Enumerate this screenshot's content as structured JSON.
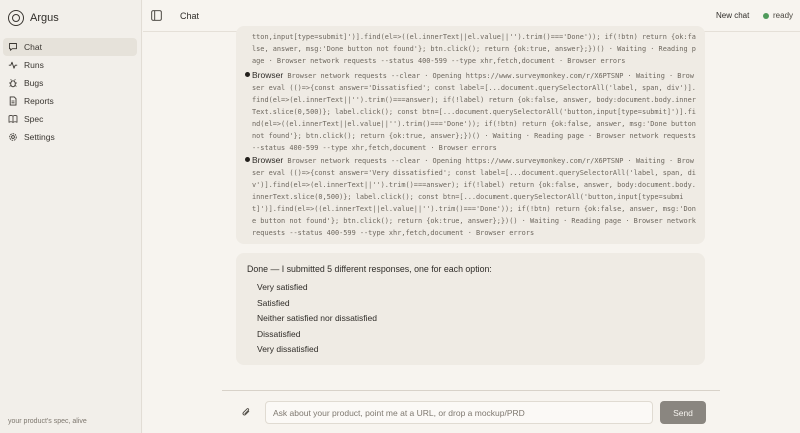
{
  "app": {
    "name": "Argus",
    "tagline": "your product's spec, alive"
  },
  "sidebar": {
    "items": [
      {
        "label": "Chat",
        "icon": "chat-bubble-icon",
        "active": true
      },
      {
        "label": "Runs",
        "icon": "activity-icon"
      },
      {
        "label": "Bugs",
        "icon": "bug-icon"
      },
      {
        "label": "Reports",
        "icon": "document-icon"
      },
      {
        "label": "Spec",
        "icon": "book-icon"
      },
      {
        "label": "Settings",
        "icon": "gear-icon"
      }
    ]
  },
  "header": {
    "title": "Chat",
    "new_chat_label": "New chat",
    "status": "ready",
    "status_color": "#4f9a5b"
  },
  "tools": {
    "partial_text": "tton,input[type=submit]')].find(el=>((el.innerText||el.value||'').trim()==='Done')); if(!btn) return {ok:false, answer, msg:'Done button not found'}; btn.click(); return {ok:true, answer};})() · Waiting · Reading page · Browser network requests --status 400-599 --type xhr,fetch,document · Browser errors",
    "entries": [
      {
        "name": "Browser",
        "text": "Browser network requests --clear · Opening https://www.surveymonkey.com/r/X6PTSNP · Waiting · Browser eval (()=>{const answer='Dissatisfied'; const label=[...document.querySelectorAll('label, span, div')].find(el=>(el.innerText||'').trim()===answer); if(!label) return {ok:false, answer, body:document.body.innerText.slice(0,500)}; label.click(); const btn=[...document.querySelectorAll('button,input[type=submit]')].find(el=>((el.innerText||el.value||'').trim()==='Done')); if(!btn) return {ok:false, answer, msg:'Done button not found'}; btn.click(); return {ok:true, answer};})() · Waiting · Reading page · Browser network requests --status 400-599 --type xhr,fetch,document · Browser errors"
      },
      {
        "name": "Browser",
        "text": "Browser network requests --clear · Opening https://www.surveymonkey.com/r/X6PTSNP · Waiting · Browser eval (()=>{const answer='Very dissatisfied'; const label=[...document.querySelectorAll('label, span, div')].find(el=>(el.innerText||'').trim()===answer); if(!label) return {ok:false, answer, body:document.body.innerText.slice(0,500)}; label.click(); const btn=[...document.querySelectorAll('button,input[type=submit]')].find(el=>((el.innerText||el.value||'').trim()==='Done')); if(!btn) return {ok:false, answer, msg:'Done button not found'}; btn.click(); return {ok:true, answer};})() · Waiting · Reading page · Browser network requests --status 400-599 --type xhr,fetch,document · Browser errors"
      }
    ]
  },
  "answer": {
    "intro": "Done — I submitted 5 different responses, one for each option:",
    "items": [
      "Very satisfied",
      "Satisfied",
      "Neither satisfied nor dissatisfied",
      "Dissatisfied",
      "Very dissatisfied"
    ]
  },
  "composer": {
    "placeholder": "Ask about your product, point me at a URL, or drop a mockup/PRD",
    "value": "",
    "send_label": "Send"
  }
}
